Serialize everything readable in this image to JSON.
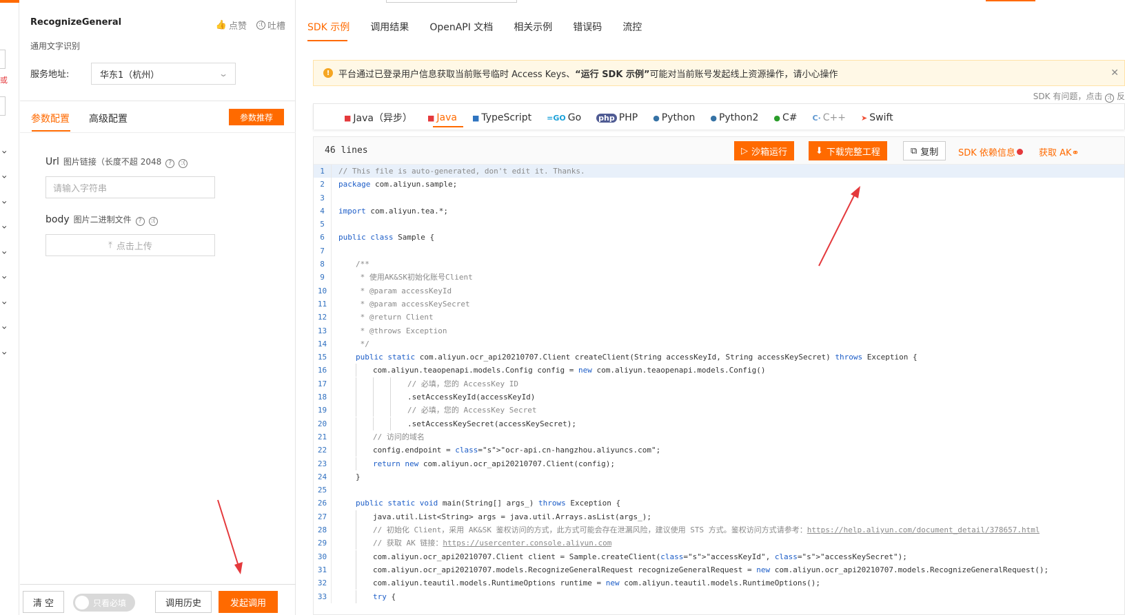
{
  "api": {
    "name": "RecognizeGeneral",
    "subtitle": "通用文字识别",
    "like_label": "点赞",
    "complain_label": "吐槽",
    "service_label": "服务地址:",
    "service_value": "华东1（杭州）"
  },
  "sliver": {
    "red_text": "或"
  },
  "config_tabs": {
    "param": "参数配置",
    "advanced": "高级配置",
    "recommend": "参数推荐"
  },
  "params": [
    {
      "name": "Url",
      "desc": "图片链接（长度不超 2048",
      "placeholder": "请输入字符串"
    },
    {
      "name": "body",
      "desc": "图片二进制文件",
      "upload": "点击上传"
    }
  ],
  "bottom": {
    "clear": "清 空",
    "required_only": "只看必填",
    "history": "调用历史",
    "invoke": "发起调用"
  },
  "main_tabs": [
    "SDK 示例",
    "调用结果",
    "OpenAPI 文档",
    "相关示例",
    "错误码",
    "流控"
  ],
  "alert": {
    "part1": "平台通过已登录用户信息获取当前账号临时 Access Keys、",
    "bold": "“运行 SDK 示例”",
    "part2": "可能对当前账号发起线上资源操作，请小心操作"
  },
  "sdk_issue": "SDK 有问题，点击",
  "sdk_issue_tail": "反",
  "languages": [
    {
      "name": "Java（异步）",
      "icon": "java-icon"
    },
    {
      "name": "Java",
      "icon": "java-icon"
    },
    {
      "name": "TypeScript",
      "icon": "typescript-icon"
    },
    {
      "name": "Go",
      "icon": "go-icon"
    },
    {
      "name": "PHP",
      "icon": "php-icon"
    },
    {
      "name": "Python",
      "icon": "python-icon"
    },
    {
      "name": "Python2",
      "icon": "python-icon"
    },
    {
      "name": "C#",
      "icon": "csharp-icon"
    },
    {
      "name": "C++",
      "icon": "cpp-icon"
    },
    {
      "name": "Swift",
      "icon": "swift-icon"
    }
  ],
  "code_header": {
    "lines": "46 lines",
    "sandbox": "沙箱运行",
    "download": "下载完整工程",
    "copy": "复制",
    "deps": "SDK 依赖信息",
    "get_ak": "获取 AK"
  },
  "code_lines": [
    "// This file is auto-generated, don't edit it. Thanks.",
    "package com.aliyun.sample;",
    "",
    "import com.aliyun.tea.*;",
    "",
    "public class Sample {",
    "",
    "    /**",
    "     * 使用AK&SK初始化账号Client",
    "     * @param accessKeyId",
    "     * @param accessKeySecret",
    "     * @return Client",
    "     * @throws Exception",
    "     */",
    "    public static com.aliyun.ocr_api20210707.Client createClient(String accessKeyId, String accessKeySecret) throws Exception {",
    "        com.aliyun.teaopenapi.models.Config config = new com.aliyun.teaopenapi.models.Config()",
    "                // 必填，您的 AccessKey ID",
    "                .setAccessKeyId(accessKeyId)",
    "                // 必填，您的 AccessKey Secret",
    "                .setAccessKeySecret(accessKeySecret);",
    "        // 访问的域名",
    "        config.endpoint = \"ocr-api.cn-hangzhou.aliyuncs.com\";",
    "        return new com.aliyun.ocr_api20210707.Client(config);",
    "    }",
    "",
    "    public static void main(String[] args_) throws Exception {",
    "        java.util.List<String> args = java.util.Arrays.asList(args_);",
    "        // 初始化 Client，采用 AK&SK 鉴权访问的方式，此方式可能会存在泄漏风险，建议使用 STS 方式。鉴权访问方式请参考：https://help.aliyun.com/document_detail/378657.html",
    "        // 获取 AK 链接：https://usercenter.console.aliyun.com",
    "        com.aliyun.ocr_api20210707.Client client = Sample.createClient(\"accessKeyId\", \"accessKeySecret\");",
    "        com.aliyun.ocr_api20210707.models.RecognizeGeneralRequest recognizeGeneralRequest = new com.aliyun.ocr_api20210707.models.RecognizeGeneralRequest();",
    "        com.aliyun.teautil.models.RuntimeOptions runtime = new com.aliyun.teautil.models.RuntimeOptions();",
    "        try {"
  ],
  "colors": {
    "accent": "#ff6a00",
    "link_blue": "#1b5cc7",
    "string_red": "#c41a16",
    "annotation_red": "#e4393c"
  }
}
